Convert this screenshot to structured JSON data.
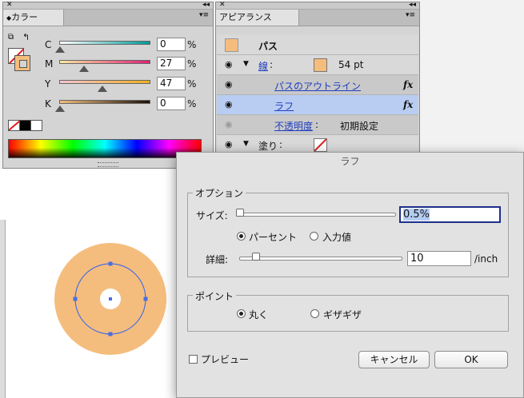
{
  "color_panel": {
    "title": "カラー",
    "channels": [
      {
        "label": "C",
        "value": "0",
        "unit": "%",
        "level": 0.0
      },
      {
        "label": "M",
        "value": "27",
        "unit": "%",
        "level": 0.27
      },
      {
        "label": "Y",
        "value": "47",
        "unit": "%",
        "level": 0.47
      },
      {
        "label": "K",
        "value": "0",
        "unit": "%",
        "level": 0.0
      }
    ],
    "fill_color": "#f5bd7d"
  },
  "appearance_panel": {
    "title": "アピアランス",
    "object_type": "パス",
    "rows": [
      {
        "label": "線",
        "separator": ":",
        "value": "54 pt"
      },
      {
        "label": "パスのアウトライン",
        "fx": "fx"
      },
      {
        "label": "ラフ",
        "fx": "fx"
      },
      {
        "label": "不透明度",
        "separator": ":",
        "value": "初期設定"
      },
      {
        "label": "塗り",
        "separator": ":"
      }
    ],
    "stroke_color": "#f5bd7d",
    "selected_row_color": "#b9cdf2"
  },
  "dialog": {
    "title": "ラフ",
    "options_group": "オプション",
    "size_label": "サイズ",
    "size_value": "0.5%",
    "size_level": 0.005,
    "unit_percent": "パーセント",
    "unit_absolute": "入力値",
    "detail_label": "詳細",
    "detail_value": "10",
    "detail_unit": "/inch",
    "detail_level": 0.1,
    "points_group": "ポイント",
    "point_smooth": "丸く",
    "point_corner": "ギザギザ",
    "preview_label": "プレビュー",
    "cancel_label": "キャンセル",
    "ok_label": "OK",
    "sep": ":"
  },
  "canvas": {
    "shape_color": "#f5bd7d",
    "selection_color": "#4a6ee0"
  }
}
